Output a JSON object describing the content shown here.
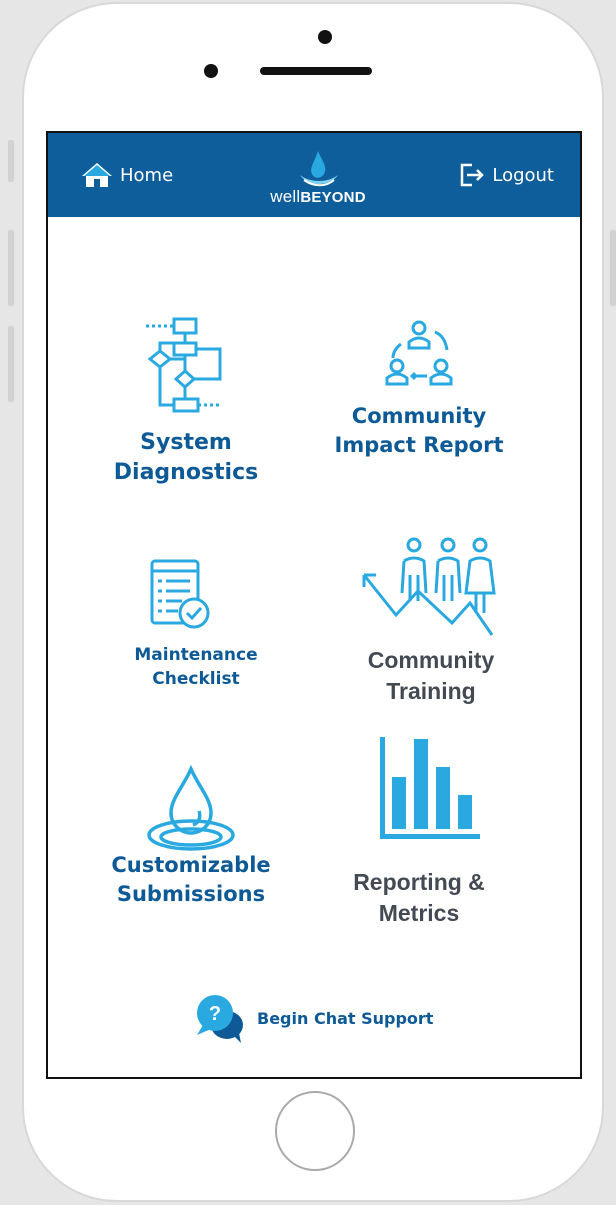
{
  "header": {
    "home_label": "Home",
    "logout_label": "Logout",
    "logo": {
      "prefix": "well",
      "suffix": "BEYOND"
    }
  },
  "tiles": [
    {
      "label_line1": "System",
      "label_line2": "Diagnostics",
      "icon": "flowchart-icon"
    },
    {
      "label_line1": "Community",
      "label_line2": "Impact Report",
      "icon": "community-cycle-icon"
    },
    {
      "label_line1": "Maintenance",
      "label_line2": "Checklist",
      "icon": "checklist-icon"
    },
    {
      "label_line1": "Community",
      "label_line2": "Training",
      "icon": "people-growth-icon"
    },
    {
      "label_line1": "Customizable",
      "label_line2": "Submissions",
      "icon": "water-drop-icon"
    },
    {
      "label_line1": "Reporting &",
      "label_line2": "Metrics",
      "icon": "bar-chart-icon"
    }
  ],
  "chat": {
    "label": "Begin Chat Support",
    "icon": "chat-help-icon"
  },
  "colors": {
    "header_bg": "#0f5e9c",
    "accent_light": "#29a9e0",
    "accent_dark": "#0d5a96",
    "label_gray": "#444a54"
  }
}
